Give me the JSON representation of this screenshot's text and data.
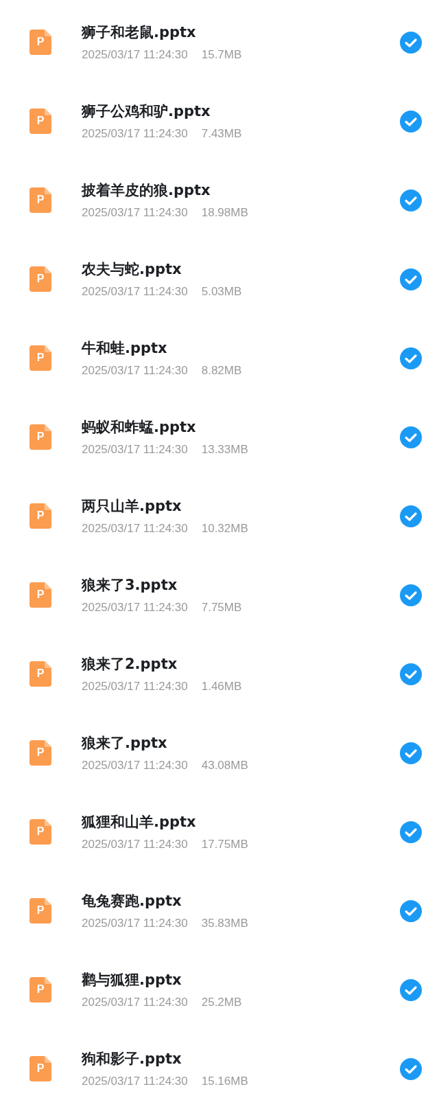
{
  "files": [
    {
      "icon_letter": "P",
      "name": "狮子和老鼠.pptx",
      "date": "2025/03/17 11:24:30",
      "size": "15.7MB",
      "selected": true
    },
    {
      "icon_letter": "P",
      "name": "狮子公鸡和驴.pptx",
      "date": "2025/03/17 11:24:30",
      "size": "7.43MB",
      "selected": true
    },
    {
      "icon_letter": "P",
      "name": "披着羊皮的狼.pptx",
      "date": "2025/03/17 11:24:30",
      "size": "18.98MB",
      "selected": true
    },
    {
      "icon_letter": "P",
      "name": "农夫与蛇.pptx",
      "date": "2025/03/17 11:24:30",
      "size": "5.03MB",
      "selected": true
    },
    {
      "icon_letter": "P",
      "name": "牛和蛙.pptx",
      "date": "2025/03/17 11:24:30",
      "size": "8.82MB",
      "selected": true
    },
    {
      "icon_letter": "P",
      "name": "蚂蚁和蚱蜢.pptx",
      "date": "2025/03/17 11:24:30",
      "size": "13.33MB",
      "selected": true
    },
    {
      "icon_letter": "P",
      "name": "两只山羊.pptx",
      "date": "2025/03/17 11:24:30",
      "size": "10.32MB",
      "selected": true
    },
    {
      "icon_letter": "P",
      "name": "狼来了3.pptx",
      "date": "2025/03/17 11:24:30",
      "size": "7.75MB",
      "selected": true
    },
    {
      "icon_letter": "P",
      "name": "狼来了2.pptx",
      "date": "2025/03/17 11:24:30",
      "size": "1.46MB",
      "selected": true
    },
    {
      "icon_letter": "P",
      "name": "狼来了.pptx",
      "date": "2025/03/17 11:24:30",
      "size": "43.08MB",
      "selected": true
    },
    {
      "icon_letter": "P",
      "name": "狐狸和山羊.pptx",
      "date": "2025/03/17 11:24:30",
      "size": "17.75MB",
      "selected": true
    },
    {
      "icon_letter": "P",
      "name": "龟兔赛跑.pptx",
      "date": "2025/03/17 11:24:30",
      "size": "35.83MB",
      "selected": true
    },
    {
      "icon_letter": "P",
      "name": "鹳与狐狸.pptx",
      "date": "2025/03/17 11:24:30",
      "size": "25.2MB",
      "selected": true
    },
    {
      "icon_letter": "P",
      "name": "狗和影子.pptx",
      "date": "2025/03/17 11:24:30",
      "size": "15.16MB",
      "selected": true
    }
  ]
}
